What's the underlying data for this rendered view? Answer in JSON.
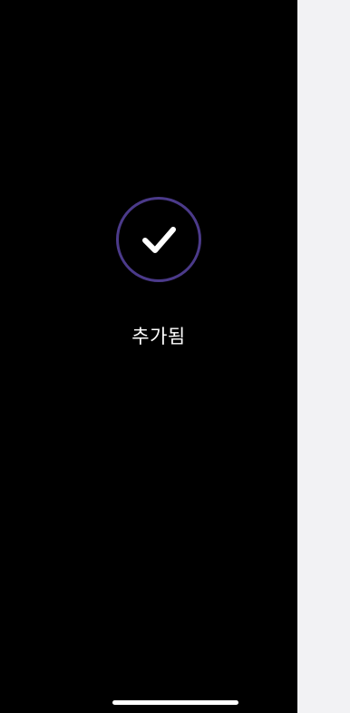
{
  "confirmation": {
    "status_text": "추가됨",
    "icon": "checkmark-icon",
    "accent_color": "#4b3a8a",
    "background_color": "#000000"
  },
  "side_panel": {
    "background_color": "#f2f2f4"
  }
}
